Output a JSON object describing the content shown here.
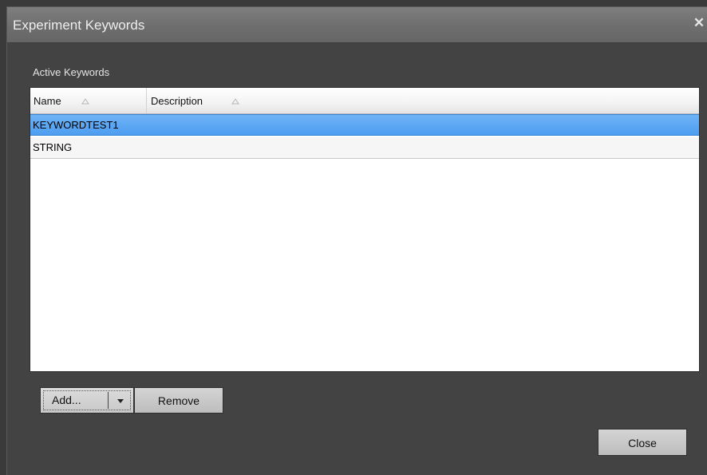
{
  "dialog": {
    "title": "Experiment Keywords",
    "close_icon": "close-icon"
  },
  "section": {
    "label": "Active Keywords"
  },
  "table": {
    "columns": [
      {
        "label": "Name",
        "sort_icon": "sort-ascending-icon"
      },
      {
        "label": "Description",
        "sort_icon": "sort-ascending-icon"
      }
    ],
    "rows": [
      {
        "name": "KEYWORDTEST1",
        "description": "",
        "selected": true
      },
      {
        "name": "STRING",
        "description": "",
        "selected": false
      }
    ]
  },
  "buttons": {
    "add_label": "Add...",
    "add_dropdown_icon": "chevron-down-icon",
    "remove_label": "Remove",
    "close_label": "Close"
  },
  "colors": {
    "selection": "#5aa6f2",
    "dialog_background": "#434343",
    "titlebar": "#707070"
  }
}
